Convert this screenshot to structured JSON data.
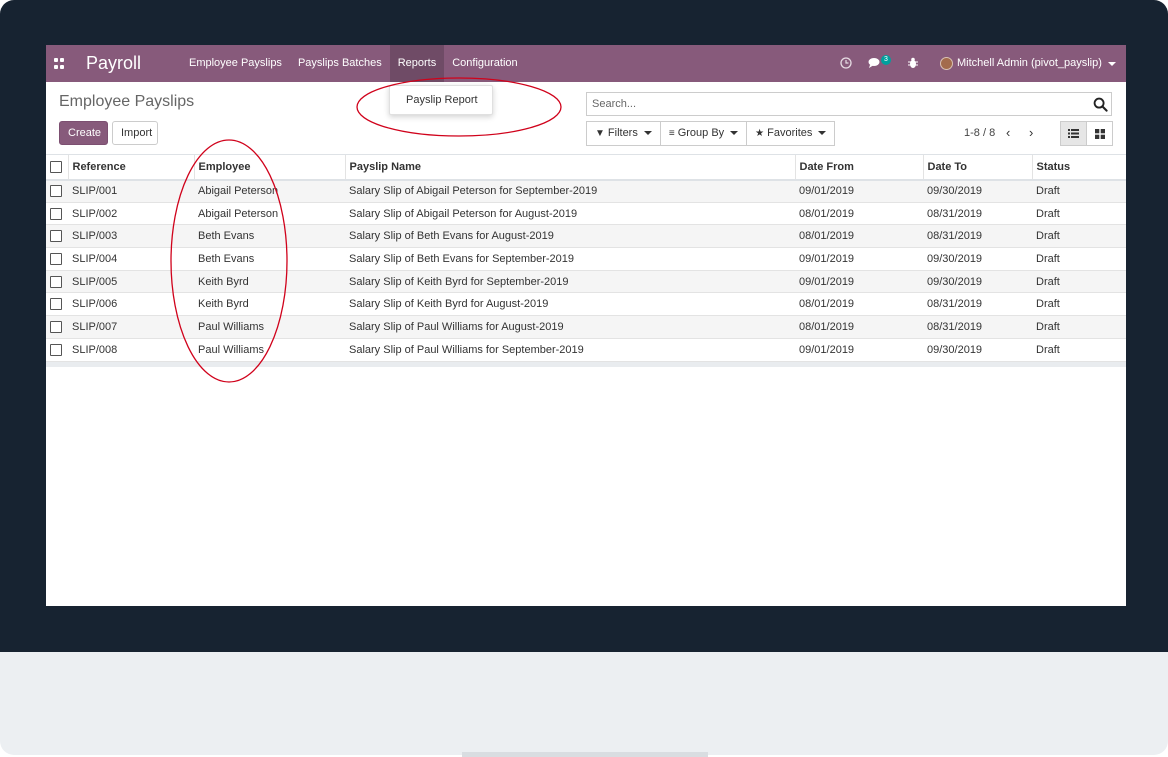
{
  "navbar": {
    "app_title": "Payroll",
    "menu": [
      "Employee Payslips",
      "Payslips Batches",
      "Reports",
      "Configuration"
    ],
    "active_menu": "Reports",
    "chat_badge": "3",
    "user": "Mitchell Admin (pivot_payslip)"
  },
  "reports_dropdown": {
    "items": [
      "Payslip Report"
    ]
  },
  "control_panel": {
    "title": "Employee Payslips",
    "create_label": "Create",
    "import_label": "Import",
    "search_placeholder": "Search...",
    "filters_label": "Filters",
    "groupby_label": "Group By",
    "favorites_label": "Favorites",
    "pager": "1-8 / 8"
  },
  "table": {
    "columns": [
      "Reference",
      "Employee",
      "Payslip Name",
      "Date From",
      "Date To",
      "Status"
    ],
    "rows": [
      [
        "SLIP/001",
        "Abigail Peterson",
        "Salary Slip of Abigail Peterson for September-2019",
        "09/01/2019",
        "09/30/2019",
        "Draft"
      ],
      [
        "SLIP/002",
        "Abigail Peterson",
        "Salary Slip of Abigail Peterson for August-2019",
        "08/01/2019",
        "08/31/2019",
        "Draft"
      ],
      [
        "SLIP/003",
        "Beth Evans",
        "Salary Slip of Beth Evans for August-2019",
        "08/01/2019",
        "08/31/2019",
        "Draft"
      ],
      [
        "SLIP/004",
        "Beth Evans",
        "Salary Slip of Beth Evans for September-2019",
        "09/01/2019",
        "09/30/2019",
        "Draft"
      ],
      [
        "SLIP/005",
        "Keith Byrd",
        "Salary Slip of Keith Byrd for September-2019",
        "09/01/2019",
        "09/30/2019",
        "Draft"
      ],
      [
        "SLIP/006",
        "Keith Byrd",
        "Salary Slip of Keith Byrd for August-2019",
        "08/01/2019",
        "08/31/2019",
        "Draft"
      ],
      [
        "SLIP/007",
        "Paul Williams",
        "Salary Slip of Paul Williams for August-2019",
        "08/01/2019",
        "08/31/2019",
        "Draft"
      ],
      [
        "SLIP/008",
        "Paul Williams",
        "Salary Slip of Paul Williams for September-2019",
        "09/01/2019",
        "09/30/2019",
        "Draft"
      ]
    ]
  },
  "colors": {
    "brand": "#875a7b",
    "annotation": "#d0021b"
  },
  "icons": {
    "apps": "apps-grid-icon",
    "clock": "clock-icon",
    "chat": "chat-icon",
    "debug": "bug-icon",
    "search": "search-icon",
    "filter": "filter-icon",
    "groupby": "list-icon",
    "favorites": "star-icon",
    "list_view": "list-view-icon",
    "kanban_view": "kanban-view-icon"
  }
}
